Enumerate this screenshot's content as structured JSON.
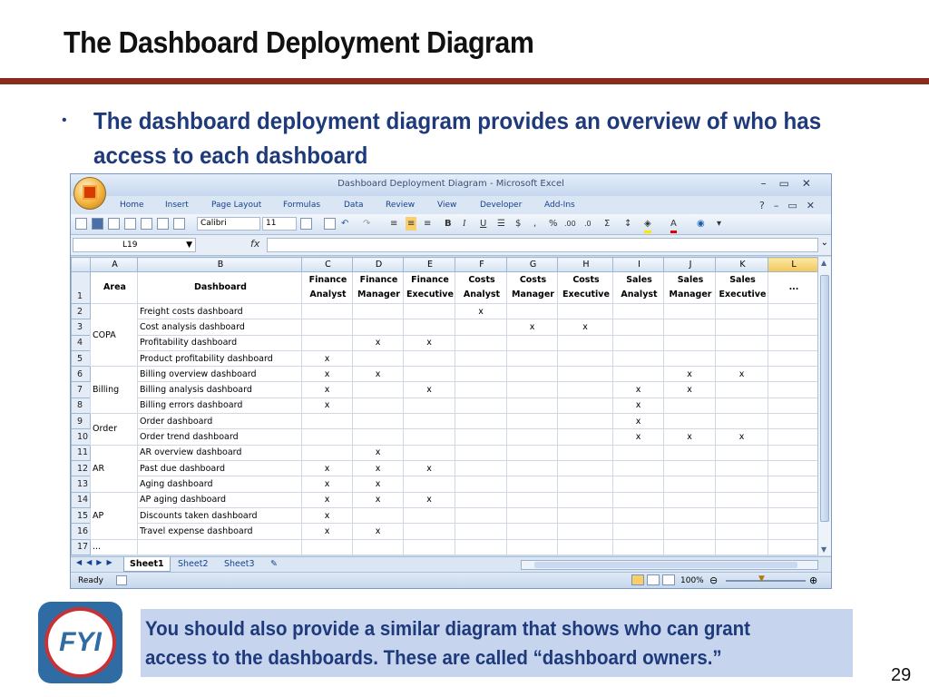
{
  "slide": {
    "title": "The Dashboard Deployment Diagram",
    "bullet": "The dashboard deployment diagram provides an overview of who has access to each dashboard",
    "note": "You should also provide a similar diagram that shows who can grant access to the dashboards. These are called “dashboard owners.”",
    "page_number": "29",
    "logo_text": "FYI",
    "accent_color": "#8b2a1f",
    "text_color": "#1f3a7a"
  },
  "excel": {
    "window_title": "Dashboard Deployment Diagram - Microsoft Excel",
    "ribbon_tabs": [
      "Home",
      "Insert",
      "Page Layout",
      "Formulas",
      "Data",
      "Review",
      "View",
      "Developer",
      "Add-Ins"
    ],
    "font_name": "Calibri",
    "font_size": "11",
    "name_box": "L19",
    "fx_label": "fx",
    "column_headers": [
      "A",
      "B",
      "C",
      "D",
      "E",
      "F",
      "G",
      "H",
      "I",
      "J",
      "K",
      "L"
    ],
    "header_row": {
      "row_num": "1",
      "area": "Area",
      "dashboard": "Dashboard",
      "roles": [
        "Finance Analyst",
        "Finance Manager",
        "Finance Executive",
        "Costs Analyst",
        "Costs Manager",
        "Costs Executive",
        "Sales Analyst",
        "Sales Manager",
        "Sales Executive"
      ],
      "more": "..."
    },
    "areas": [
      "COPA",
      "Billing",
      "Order",
      "AR",
      "AP"
    ],
    "rows": [
      {
        "num": "2",
        "dashboard": "Freight costs dashboard",
        "c": "",
        "d": "",
        "e": "",
        "f": "x",
        "g": "",
        "h": "",
        "i": "",
        "j": "",
        "k": ""
      },
      {
        "num": "3",
        "dashboard": "Cost analysis dashboard",
        "c": "",
        "d": "",
        "e": "",
        "f": "",
        "g": "x",
        "h": "x",
        "i": "",
        "j": "",
        "k": ""
      },
      {
        "num": "4",
        "dashboard": "Profitability dashboard",
        "c": "",
        "d": "x",
        "e": "x",
        "f": "",
        "g": "",
        "h": "",
        "i": "",
        "j": "",
        "k": ""
      },
      {
        "num": "5",
        "dashboard": "Product profitability  dashboard",
        "c": "x",
        "d": "",
        "e": "",
        "f": "",
        "g": "",
        "h": "",
        "i": "",
        "j": "",
        "k": ""
      },
      {
        "num": "6",
        "dashboard": "Billing overview dashboard",
        "c": "x",
        "d": "x",
        "e": "",
        "f": "",
        "g": "",
        "h": "",
        "i": "",
        "j": "x",
        "k": "x"
      },
      {
        "num": "7",
        "dashboard": "Billing analysis dashboard",
        "c": "x",
        "d": "",
        "e": "x",
        "f": "",
        "g": "",
        "h": "",
        "i": "x",
        "j": "x",
        "k": ""
      },
      {
        "num": "8",
        "dashboard": "Billing errors dashboard",
        "c": "x",
        "d": "",
        "e": "",
        "f": "",
        "g": "",
        "h": "",
        "i": "x",
        "j": "",
        "k": ""
      },
      {
        "num": "9",
        "dashboard": "Order dashboard",
        "c": "",
        "d": "",
        "e": "",
        "f": "",
        "g": "",
        "h": "",
        "i": "x",
        "j": "",
        "k": ""
      },
      {
        "num": "10",
        "dashboard": "Order trend  dashboard",
        "c": "",
        "d": "",
        "e": "",
        "f": "",
        "g": "",
        "h": "",
        "i": "x",
        "j": "x",
        "k": "x"
      },
      {
        "num": "11",
        "dashboard": "AR overview dashboard",
        "c": "",
        "d": "x",
        "e": "",
        "f": "",
        "g": "",
        "h": "",
        "i": "",
        "j": "",
        "k": ""
      },
      {
        "num": "12",
        "dashboard": "Past due dashboard",
        "c": "x",
        "d": "x",
        "e": "x",
        "f": "",
        "g": "",
        "h": "",
        "i": "",
        "j": "",
        "k": ""
      },
      {
        "num": "13",
        "dashboard": "Aging  dashboard",
        "c": "x",
        "d": "x",
        "e": "",
        "f": "",
        "g": "",
        "h": "",
        "i": "",
        "j": "",
        "k": ""
      },
      {
        "num": "14",
        "dashboard": "AP aging dashboard",
        "c": "x",
        "d": "x",
        "e": "x",
        "f": "",
        "g": "",
        "h": "",
        "i": "",
        "j": "",
        "k": ""
      },
      {
        "num": "15",
        "dashboard": "Discounts taken dashboard",
        "c": "x",
        "d": "",
        "e": "",
        "f": "",
        "g": "",
        "h": "",
        "i": "",
        "j": "",
        "k": ""
      },
      {
        "num": "16",
        "dashboard": "Travel expense dashboard",
        "c": "x",
        "d": "x",
        "e": "",
        "f": "",
        "g": "",
        "h": "",
        "i": "",
        "j": "",
        "k": ""
      }
    ],
    "last_row": {
      "num": "17",
      "text": "..."
    },
    "sheet_tabs": [
      "Sheet1",
      "Sheet2",
      "Sheet3"
    ],
    "status": "Ready",
    "zoom": "100%"
  }
}
